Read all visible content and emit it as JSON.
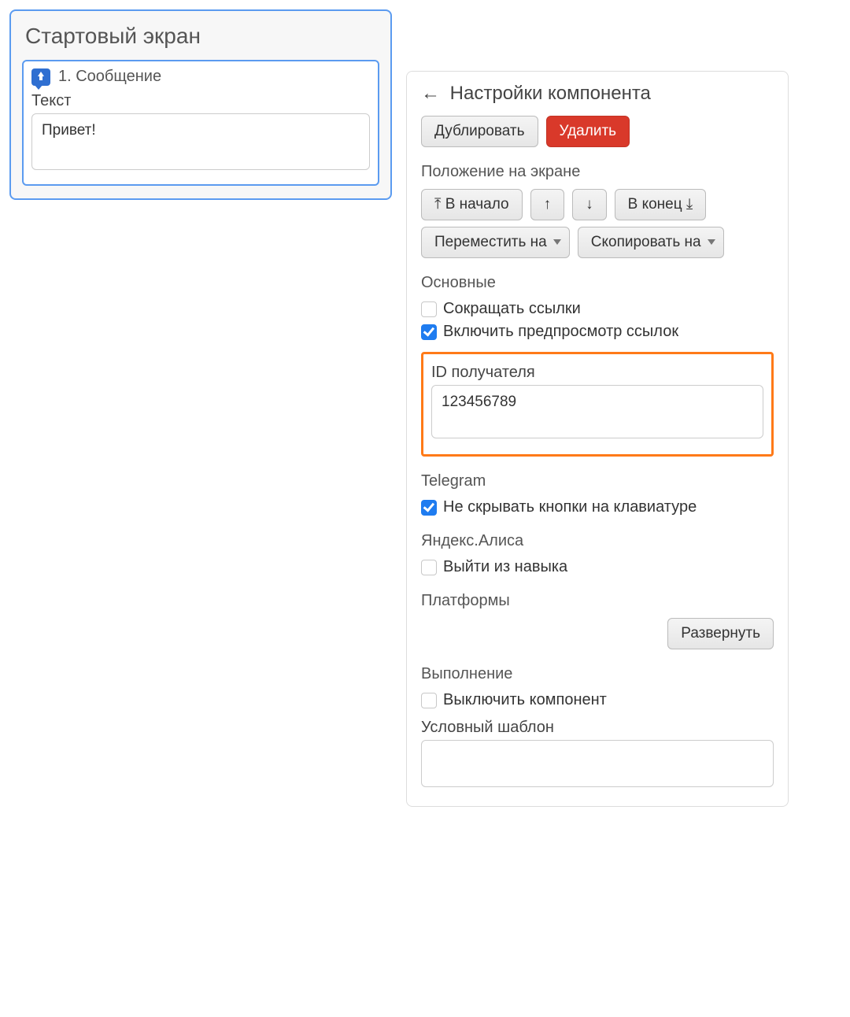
{
  "screen": {
    "title": "Стартовый экран",
    "component": {
      "title": "1. Сообщение",
      "text_label": "Текст",
      "text_value": "Привет!"
    }
  },
  "settings": {
    "title": "Настройки компонента",
    "duplicate": "Дублировать",
    "delete": "Удалить",
    "position_label": "Положение на экране",
    "to_start": "В начало",
    "up": "↑",
    "down": "↓",
    "to_end": "В конец",
    "move_to": "Переместить на",
    "copy_to": "Скопировать на",
    "main_label": "Основные",
    "shorten_links": "Сокращать ссылки",
    "preview_links": "Включить предпросмотр ссылок",
    "recipient_id_label": "ID получателя",
    "recipient_id_value": "123456789",
    "telegram_label": "Telegram",
    "telegram_keep_kb": "Не скрывать кнопки на клавиатуре",
    "alice_label": "Яндекс.Алиса",
    "alice_exit": "Выйти из навыка",
    "platforms_label": "Платформы",
    "expand": "Развернуть",
    "execution_label": "Выполнение",
    "disable_component": "Выключить компонент",
    "template_label": "Условный шаблон"
  },
  "checks": {
    "shorten_links": false,
    "preview_links": true,
    "telegram_keep_kb": true,
    "alice_exit": false,
    "disable_component": false
  }
}
